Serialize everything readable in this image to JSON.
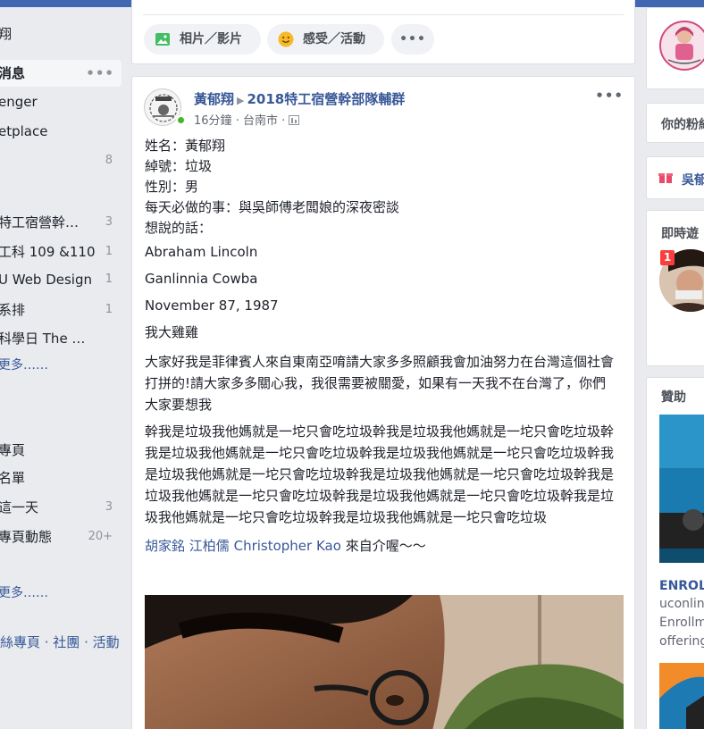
{
  "sidebar": {
    "items": [
      {
        "label": "翔",
        "count": ""
      },
      {
        "label": "消息",
        "count": ""
      },
      {
        "label": "enger",
        "count": ""
      },
      {
        "label": "etplace",
        "count": ""
      },
      {
        "label": "",
        "count": "8"
      },
      {
        "label": "特工宿營幹…",
        "count": "3"
      },
      {
        "label": "工科 109 &110",
        "count": "1"
      },
      {
        "label": "U Web Design",
        "count": "1"
      },
      {
        "label": "系排",
        "count": "1"
      },
      {
        "label": "科學日 The …",
        "count": ""
      },
      {
        "label": "更多……",
        "count": ""
      },
      {
        "label": "專頁",
        "count": ""
      },
      {
        "label": "名單",
        "count": ""
      },
      {
        "label": "這一天",
        "count": "3"
      },
      {
        "label": "專頁動態",
        "count": "20+"
      },
      {
        "label": "更多……",
        "count": ""
      }
    ],
    "active_dots": "•••",
    "footer": "絲專頁 · 社團 · 活動"
  },
  "composer": {
    "photo_video": "相片／影片",
    "feeling": "感受／活動",
    "more": "•••"
  },
  "post": {
    "author": "黃郁翔",
    "group": "2018特工宿營幹部隊輔群",
    "time": "16分鐘",
    "location": "台南市",
    "menu": "•••",
    "lines": [
      "姓名：黃郁翔",
      "綽號：垃圾",
      "性別：男",
      "每天必做的事：與吳師傅老闆娘的深夜密談",
      "想說的話："
    ],
    "english": [
      "Abraham Lincoln",
      "Ganlinnia Cowba",
      "November 87, 1987"
    ],
    "exclaim": "我大雞雞",
    "para1": "大家好我是菲律賓人來自東南亞唷請大家多多照顧我會加油努力在台灣這個社會打拼的!請大家多多關心我，我很需要被關愛，如果有一天我不在台灣了，你們大家要想我",
    "para2": "幹我是垃圾我他媽就是一坨只會吃垃圾幹我是垃圾我他媽就是一坨只會吃垃圾幹我是垃圾我他媽就是一坨只會吃垃圾幹我是垃圾我他媽就是一坨只會吃垃圾幹我是垃圾我他媽就是一坨只會吃垃圾幹我是垃圾我他媽就是一坨只會吃垃圾幹我是垃圾我他媽就是一坨只會吃垃圾幹我是垃圾我他媽就是一坨只會吃垃圾幹我是垃圾我他媽就是一坨只會吃垃圾幹我是垃圾我他媽就是一坨只會吃垃圾",
    "tag1": "胡家銘",
    "tag2": "江柏儒",
    "tag3": "Christopher Kao",
    "tag_suffix": " 來自介喔～～"
  },
  "right": {
    "fans_title": "你的粉絲",
    "wu_title": "吳郁",
    "games_title": "即時遊",
    "badge": "1",
    "sponsored": "贊助",
    "ad_title": "ENROL",
    "ad_domain": "uconlin",
    "ad_text1": "Enrollm",
    "ad_text2": "offering"
  }
}
